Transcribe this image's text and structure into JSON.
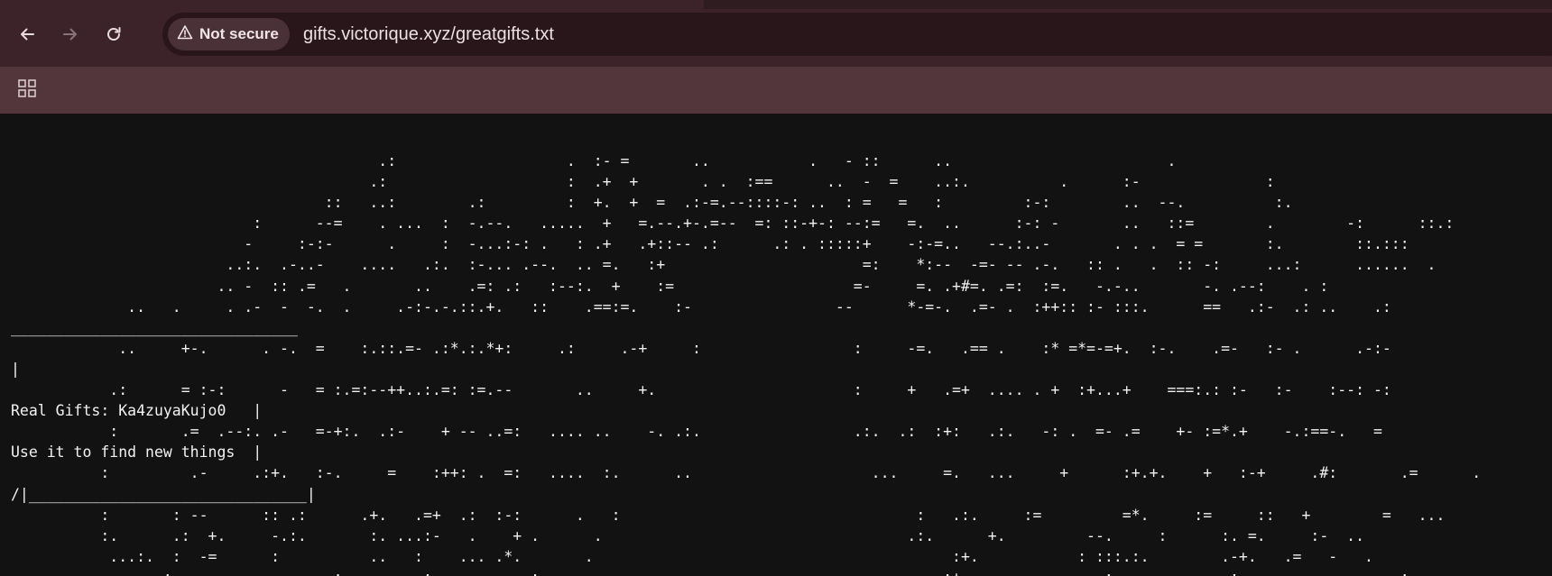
{
  "toolbar": {
    "back_icon": "arrow-left-icon",
    "forward_icon": "arrow-right-icon",
    "reload_icon": "reload-icon",
    "security_label": "Not secure",
    "security_icon": "warning-triangle-icon",
    "url": "gifts.victorique.xyz/greatgifts.txt"
  },
  "bookmarks": {
    "apps_icon": "apps-grid-icon"
  },
  "document": {
    "lines": [
      "                                         .:                   .  :- =       ..           .   - ::      ..                        .",
      "                                        .:                    :  .+  +       . .  :==      ..  -  =    ..:.          .      :-              :",
      "                                   ::   ..:        .:         :  +.  +  =  .:-=.--::::-: ..  : =   =   :         :-:        ..  --.          :.",
      "                           :      --=    . ...  :  -.--.   .....  +   =.--.+-.=--  =: ::-+-: --:=   =.  ..      :-: -       ..   ::=        .        -:      ::.:",
      "                          -     :-:-      .     :  -...:-: .   : .+   .+::-- .:      .: . :::::+    -:-=..   --.:..-       . . .  = =       :.        ::.:::",
      "                        ..:.  .-..-    ....   .:.  :-... .--.  .. =.   :+                      =:    *:--  -=- -- .-.   :: .   .  :: -:     ...:      ......  .",
      "                       .. -  :: .=   .       ..    .=: .:   :--:.  +    :=                    =-     =. .+#=. .=:  :=.   -.-..       -. .--:    . :",
      "             ..   .     . .-  -  -.  .     .-:-.-.::.+.   ::    .==:=.    :-                --      *-=-.  .=- .  :++:: :- :::.      ==   .:-  .: ..    .:",
      "________________________________",
      "            ..     +-.      . -.  =    :.::.=- .:*.:.*+:     .:     .-+     :                 :     -=.   .== .    :* =*=-=+.  :-.    .=-   :- .      .-:-",
      "|",
      "           .:      = :-:      -   = :.=:--++..:.=: :=.--       ..     +.                      :     +   .=+  .... . +  :+...+    ===:.: :-   :-    :--: -:",
      "Real Gifts: Ka4zuyaKujo0   |",
      "           :       .=  .--:. .-   =-+:.  .:-    + -- ..=:   .... ..    -. .:.                 .:.  .:  :+:   .:.   -: .  =- .=    +- :=*.+    -.:==-.   =",
      "Use it to find new things  |",
      "          :         .-     .:+.   :-.     =    :++: .  =:   ....  :.      ..                    ...     =.   ...     +      :+.+.    +   :-+     .#:       .=      .",
      "/|_______________________________|",
      "          :       : --      :: .:      .+.   .=+  .:  :-:      .   :                                 :   .:.     :=         =*.     :=     ::   +        =   ...",
      "          :.      .:  +.     -.:.       :. ...:-   .    + .      .                                  .:.      +.         --.     :      :. =.     :-  ..",
      "           ...:.  :  -=      :          ..   :    ... .*.       .                                        :+.           : :::.:.        .-+.   .=   -   .",
      "              .  :         .       .:         :     .  .  :  .                                          :+.  .     .      :       ..    :  .    .  .    .  :"
    ]
  }
}
